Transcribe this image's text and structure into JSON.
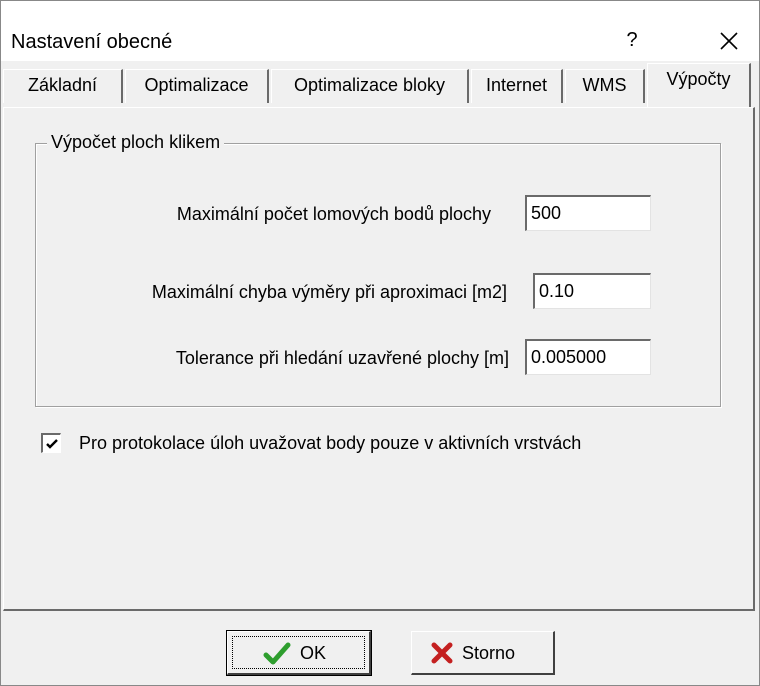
{
  "window": {
    "title": "Nastavení obecné",
    "help_label": "?"
  },
  "tabs": [
    {
      "label": "Základní",
      "active": false
    },
    {
      "label": "Optimalizace",
      "active": false
    },
    {
      "label": "Optimalizace bloky",
      "active": false
    },
    {
      "label": "Internet",
      "active": false
    },
    {
      "label": "WMS",
      "active": false
    },
    {
      "label": "Výpočty",
      "active": true
    }
  ],
  "group": {
    "legend": "Výpočet ploch klikem",
    "fields": [
      {
        "label": "Maximální počet lomových bodů plochy",
        "value": "500"
      },
      {
        "label": "Maximální chyba výměry při aproximaci  [m2]",
        "value": "0.10"
      },
      {
        "label": "Tolerance při hledání uzavřené plochy [m]",
        "value": "0.005000"
      }
    ]
  },
  "checkbox": {
    "label": "Pro protokolace úloh uvažovat body pouze v aktivních vrstvách",
    "checked": true
  },
  "buttons": {
    "ok_label": "OK",
    "ok_icon": "checkmark-icon",
    "cancel_label": "Storno",
    "cancel_icon": "x-icon"
  },
  "colors": {
    "ok_icon": "#2e9e2e",
    "cancel_icon": "#c42020"
  }
}
